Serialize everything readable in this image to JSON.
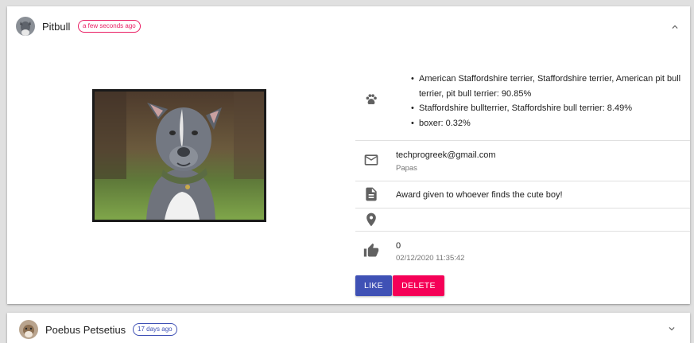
{
  "posts": [
    {
      "title": "Pitbull",
      "time_ago": "a few seconds ago",
      "chip_color": "#e91e63",
      "expanded": true,
      "breeds": [
        "American Staffordshire terrier, Staffordshire terrier, American pit bull terrier, pit bull terrier: 90.85%",
        "Staffordshire bullterrier, Staffordshire bull terrier: 8.49%",
        "boxer: 0.32%"
      ],
      "email": "techprogreek@gmail.com",
      "username": "Papas",
      "description": "Award given to whoever finds the cute boy!",
      "location": "",
      "likes": "0",
      "date": "02/12/2020 11:35:42",
      "like_label": "LIKE",
      "delete_label": "DELETE",
      "icons": [
        "paw-icon",
        "email-icon",
        "document-icon",
        "location-pin-icon",
        "thumbs-up-icon",
        "chevron-up-icon"
      ]
    },
    {
      "title": "Poebus Petsetius",
      "time_ago": "17 days ago",
      "chip_color": "#3f51b5",
      "expanded": false,
      "icons": [
        "chevron-down-icon"
      ]
    }
  ],
  "colors": {
    "like_button": "#3f51b5",
    "delete_button": "#f50057",
    "background": "#e0e0e0"
  }
}
